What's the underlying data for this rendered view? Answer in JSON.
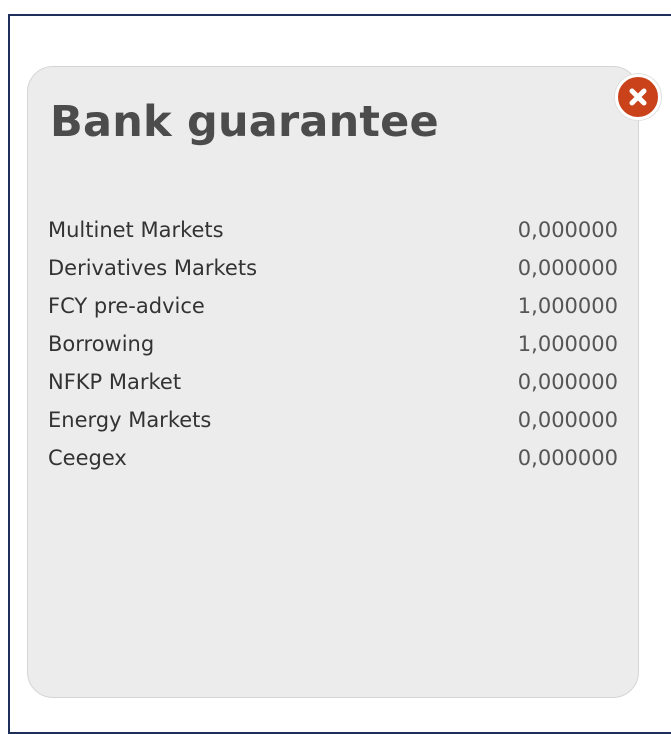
{
  "panel": {
    "title": "Bank guarantee",
    "close_icon": "close-icon",
    "accent_color": "#c9421a",
    "rows": [
      {
        "label": "Multinet Markets",
        "value": "0,000000"
      },
      {
        "label": "Derivatives Markets",
        "value": "0,000000"
      },
      {
        "label": "FCY pre-advice",
        "value": "1,000000"
      },
      {
        "label": "Borrowing",
        "value": "1,000000"
      },
      {
        "label": "NFKP Market",
        "value": "0,000000"
      },
      {
        "label": "Energy Markets",
        "value": "0,000000"
      },
      {
        "label": "Ceegex",
        "value": "0,000000"
      }
    ]
  }
}
